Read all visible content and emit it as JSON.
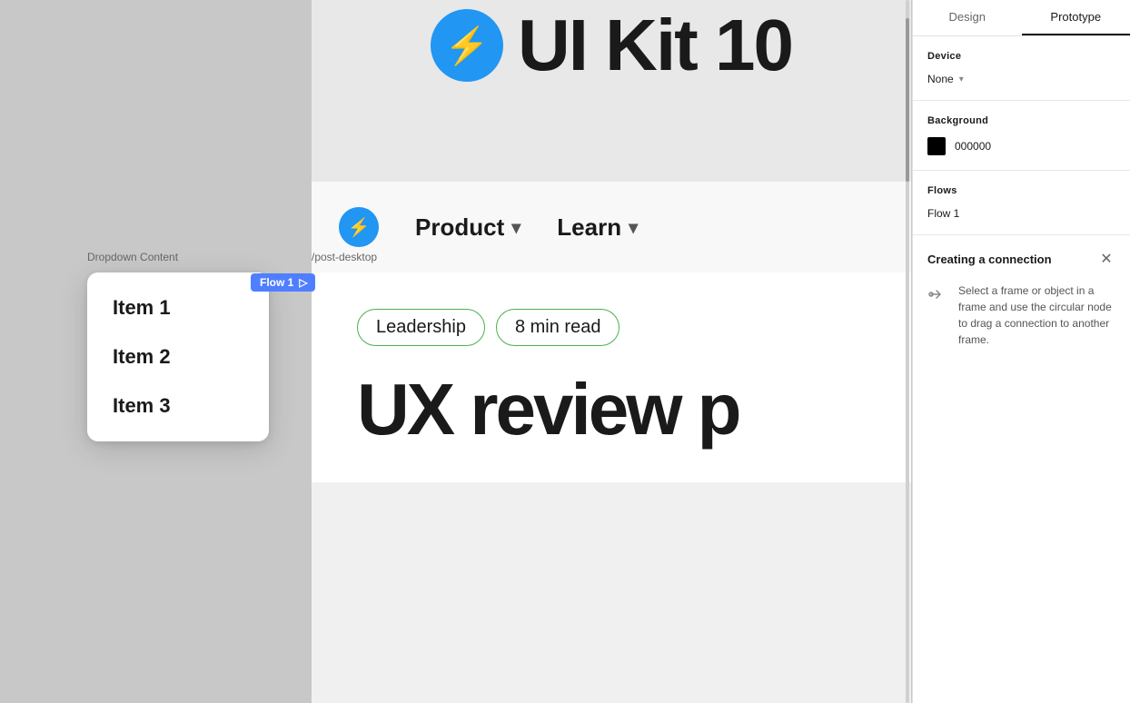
{
  "tabs": {
    "design_label": "Design",
    "prototype_label": "Prototype",
    "active_tab": "Prototype"
  },
  "right_panel": {
    "device_section": {
      "title": "Device",
      "value": "None"
    },
    "background_section": {
      "title": "Background",
      "color_hex": "000000",
      "color_value": "000000"
    },
    "flows_section": {
      "title": "Flows",
      "flow_name": "Flow 1"
    }
  },
  "connection_panel": {
    "title": "Creating a connection",
    "description": "Select a frame or object in a frame and use the circular node to drag a connection to another frame."
  },
  "canvas": {
    "dropdown_label": "Dropdown Content",
    "path_label": "/post-desktop",
    "flow_badge": "Flow 1"
  },
  "dropdown_menu": {
    "items": [
      {
        "label": "Item 1"
      },
      {
        "label": "Item 2"
      },
      {
        "label": "Item 3"
      }
    ]
  },
  "frame": {
    "nav_items": [
      {
        "label": "Product"
      },
      {
        "label": "Learn"
      }
    ],
    "tags": [
      {
        "label": "Leadership"
      },
      {
        "label": "8 min read"
      }
    ],
    "headline": "UX review p"
  }
}
